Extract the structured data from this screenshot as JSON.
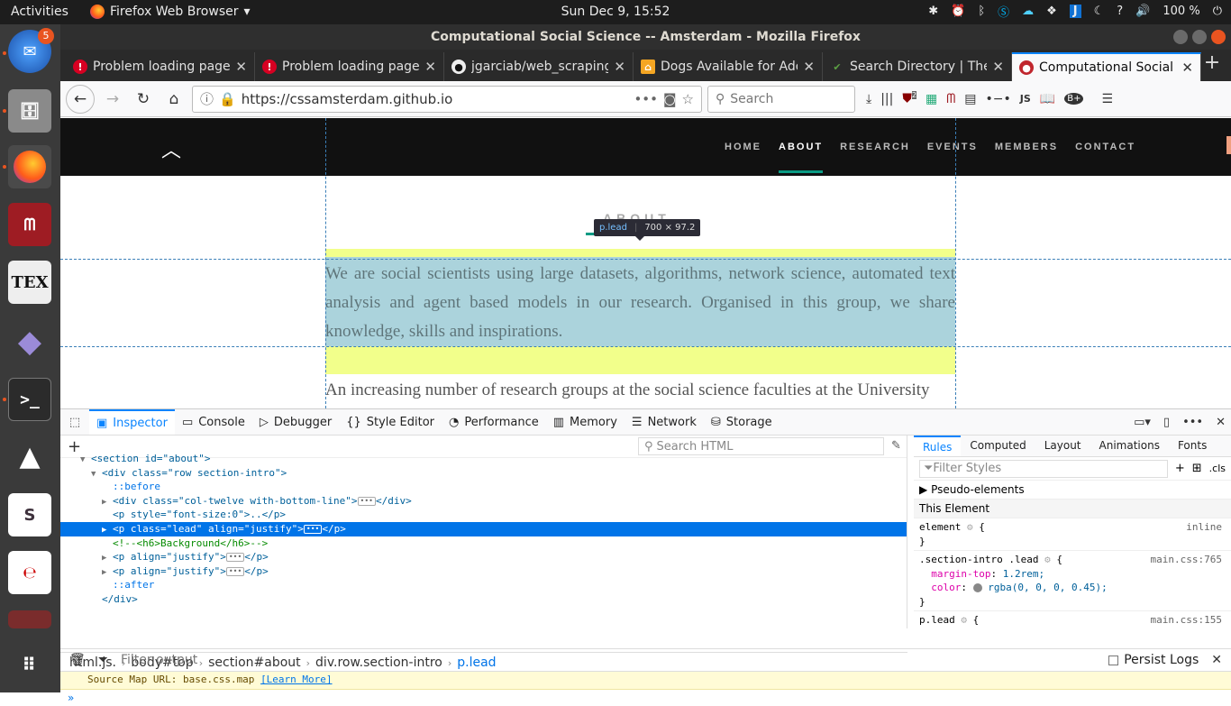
{
  "topbar": {
    "activities": "Activities",
    "app": "Firefox Web Browser",
    "clock": "Sun Dec  9, 15:52",
    "tray_help": "?",
    "battery": "100 %"
  },
  "dock": {
    "thunderbird_badge": "5"
  },
  "window": {
    "title": "Computational Social Science -- Amsterdam - Mozilla Firefox"
  },
  "tabs": [
    {
      "label": "Problem loading page",
      "icon": "error-icon"
    },
    {
      "label": "Problem loading page",
      "icon": "error-icon"
    },
    {
      "label": "jgarciab/web_scraping",
      "icon": "github-icon"
    },
    {
      "label": "Dogs Available for Ado",
      "icon": "dog-icon"
    },
    {
      "label": "Search Directory | The",
      "icon": "check-icon"
    },
    {
      "label": "Computational Social S",
      "icon": "site-icon"
    }
  ],
  "navbar": {
    "url": "https://cssamsterdam.github.io",
    "search_placeholder": "Search",
    "ublock_badge": "2",
    "js_label": "JS"
  },
  "site": {
    "menu": [
      "HOME",
      "ABOUT",
      "RESEARCH",
      "EVENTS",
      "MEMBERS",
      "CONTACT"
    ],
    "about_heading": "ABOUT",
    "tooltip_selector": "p.lead",
    "tooltip_size": "700 × 97.2",
    "lead": "We are social scientists using large datasets, algorithms, network science, automated text analysis and agent based models in our research. Organised in this group, we share knowledge, skills and inspirations.",
    "p2": "An increasing number of research groups at the social science faculties at the University"
  },
  "devtools": {
    "tabs": [
      "Inspector",
      "Console",
      "Debugger",
      "Style Editor",
      "Performance",
      "Memory",
      "Network",
      "Storage"
    ],
    "search_html": "Search HTML",
    "tree": [
      {
        "text": "<section id=\"about\">"
      },
      {
        "text": "<div class=\"row section-intro\">"
      },
      {
        "text": "::before"
      },
      {
        "text": "<div class=\"col-twelve with-bottom-line\">"
      },
      {
        "text": "<p style=\"font-size:0\">..</p>"
      },
      {
        "text": "<p class=\"lead\" align=\"justify\">"
      },
      {
        "text": "<!--<h6>Background</h6>-->"
      },
      {
        "text": "<p align=\"justify\">"
      },
      {
        "text": "<p align=\"justify\">"
      },
      {
        "text": "::after"
      },
      {
        "text": "</div>"
      }
    ],
    "breadcrumbs": [
      "html.js.",
      "body#top",
      "section#about",
      "div.row.section-intro",
      "p.lead"
    ],
    "rules_tabs": [
      "Rules",
      "Computed",
      "Layout",
      "Animations",
      "Fonts"
    ],
    "filter_styles": "Filter Styles",
    "cls": ".cls",
    "pseudo": "Pseudo-elements",
    "this_element": "This Element",
    "rule1": {
      "selector": "element",
      "src": "inline"
    },
    "rule2": {
      "selector": ".section-intro .lead",
      "src": "main.css:765",
      "p1": "margin-top",
      "v1": "1.2rem;",
      "p2": "color",
      "v2": "rgba(0, 0, 0, 0.45);"
    },
    "rule3": {
      "selector": "p.lead",
      "src": "main.css:155"
    },
    "console_filter": "Filter output",
    "persist": "Persist Logs",
    "console_msg": "Source Map URL: base.css.map",
    "learn_more": "[Learn More]"
  }
}
